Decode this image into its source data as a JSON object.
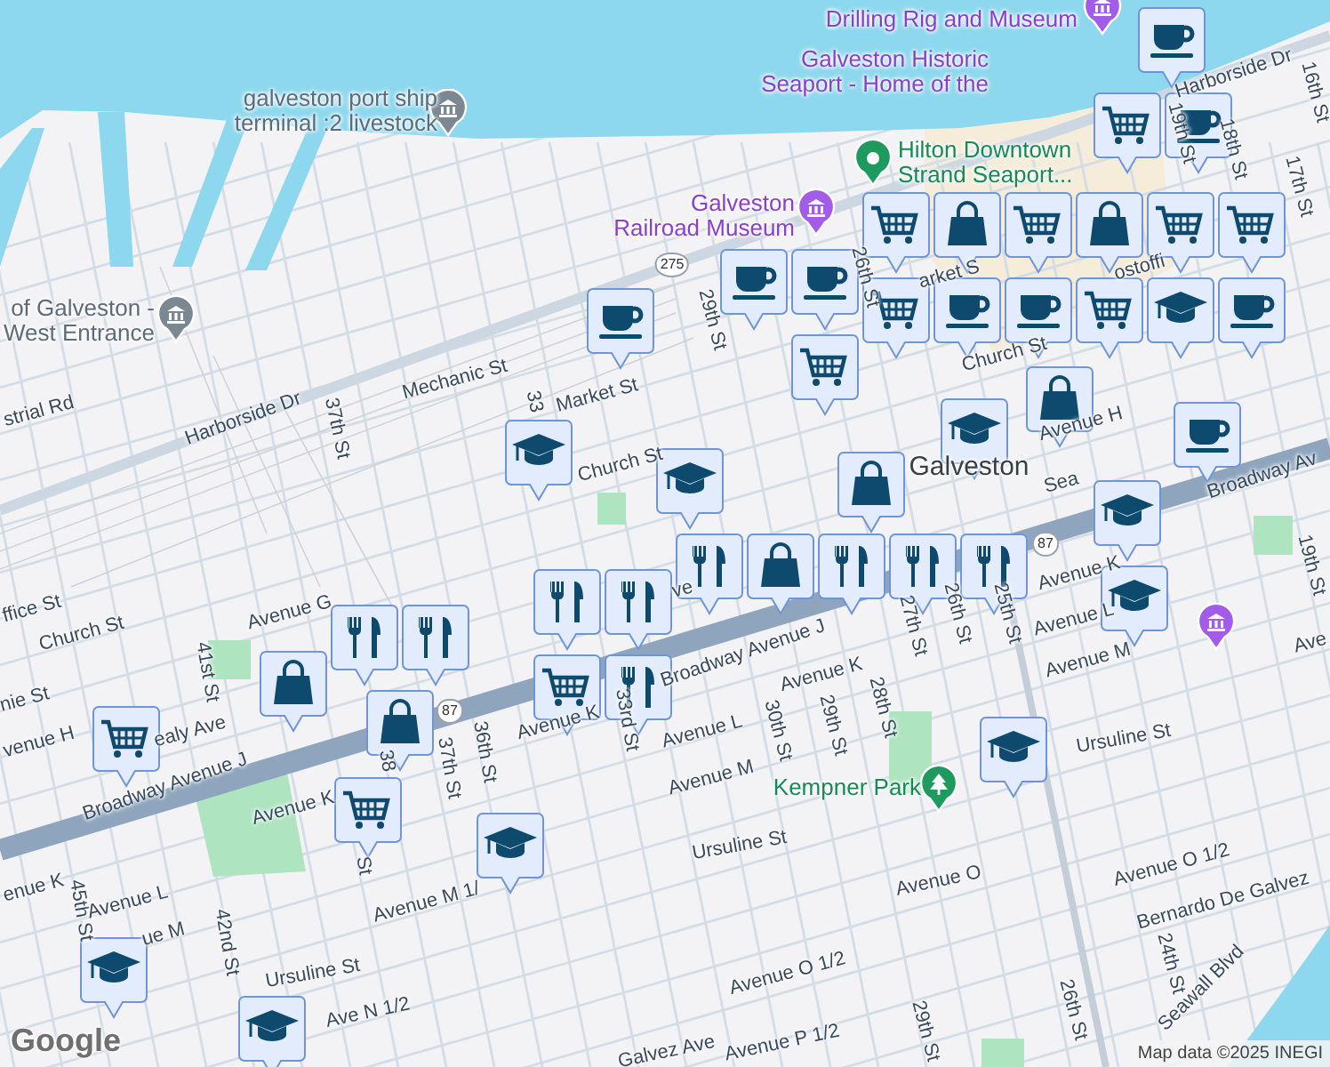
{
  "map": {
    "poi_labels": [
      {
        "lines": [
          "galveston port ship",
          "terminal :2 livestock"
        ],
        "kind": "landmark"
      },
      {
        "lines": [
          "of Galveston -",
          "West Entrance"
        ],
        "kind": "landmark"
      },
      {
        "lines": [
          "Galveston",
          "Railroad Museum"
        ],
        "kind": "attraction"
      },
      {
        "lines": [
          "Drilling Rig and Museum"
        ],
        "kind": "attraction"
      },
      {
        "lines": [
          "Galveston Historic",
          "Seaport - Home of the"
        ],
        "kind": "attraction"
      },
      {
        "lines": [
          "Hilton Downtown",
          "Strand Seaport..."
        ],
        "kind": "hotel"
      },
      {
        "lines": [
          "Galveston"
        ],
        "kind": "city"
      },
      {
        "lines": [
          "Kempner Park"
        ],
        "kind": "park"
      }
    ],
    "places": [
      {
        "kind": "landmark"
      },
      {
        "kind": "landmark"
      },
      {
        "kind": "attraction"
      },
      {
        "kind": "attraction"
      },
      {
        "kind": "hotel"
      },
      {
        "kind": "attraction"
      },
      {
        "kind": "park"
      }
    ],
    "streets": [
      "strial Rd",
      "Harborside Dr",
      "Mechanic St",
      "37th St",
      "33",
      "Market St",
      "Church St",
      "29th St",
      "26th St",
      "arket S",
      "Church St",
      "Harborside Dr",
      "19th St",
      "18th St",
      "17th St",
      "16th St",
      "ostoffi",
      "Avenue H",
      "Sea",
      "Broadway Av",
      "Avenue K",
      "Avenue L",
      "Avenue M",
      "19th St",
      "ffice St",
      "Church St",
      "Avenue G",
      "nie St",
      "venue H",
      "ealy Ave",
      "41st St",
      "Broadway Avenue J",
      "Avenue K",
      "38",
      "37th St",
      "36th St",
      "Avenue K",
      "33rd St",
      "St",
      "enue K",
      "45th St",
      "Avenue L",
      "ue M",
      "42nd St",
      "Avenue M 1/",
      "Ursuline St",
      "Ave N 1/2",
      "ve",
      "Broadway Avenue J",
      "Avenue K",
      "27th St",
      "26th St",
      "25th St",
      "30th St",
      "29th St",
      "28th St",
      "Avenue L",
      "Avenue M",
      "Ursuline St",
      "Ursuline St",
      "Avenue O",
      "Avenue O 1/2",
      "Bernardo De Galvez",
      "24th St",
      "Seawall Blvd",
      "26th St",
      "Avenue O 1/2",
      "29th St",
      "Avenue P 1/2",
      "Galvez Ave",
      "Ave"
    ],
    "route_shields": [
      "275",
      "87",
      "87"
    ],
    "markers": [
      {
        "kind": "cafe"
      },
      {
        "kind": "school"
      },
      {
        "kind": "school"
      },
      {
        "kind": "cafe"
      },
      {
        "kind": "cafe"
      },
      {
        "kind": "cart"
      },
      {
        "kind": "cart"
      },
      {
        "kind": "shop"
      },
      {
        "kind": "cart"
      },
      {
        "kind": "shop"
      },
      {
        "kind": "cart"
      },
      {
        "kind": "cart"
      },
      {
        "kind": "cart"
      },
      {
        "kind": "cart"
      },
      {
        "kind": "cafe"
      },
      {
        "kind": "cafe"
      },
      {
        "kind": "cafe"
      },
      {
        "kind": "cafe"
      },
      {
        "kind": "cart"
      },
      {
        "kind": "school"
      },
      {
        "kind": "cafe"
      },
      {
        "kind": "school"
      },
      {
        "kind": "cafe"
      },
      {
        "kind": "school"
      },
      {
        "kind": "shop"
      },
      {
        "kind": "shop"
      },
      {
        "kind": "shop"
      },
      {
        "kind": "food"
      },
      {
        "kind": "food"
      },
      {
        "kind": "food"
      },
      {
        "kind": "food"
      },
      {
        "kind": "food"
      },
      {
        "kind": "food"
      },
      {
        "kind": "food"
      },
      {
        "kind": "cart"
      },
      {
        "kind": "food"
      },
      {
        "kind": "food"
      },
      {
        "kind": "shop"
      },
      {
        "kind": "shop"
      },
      {
        "kind": "cart"
      },
      {
        "kind": "cart"
      },
      {
        "kind": "school"
      },
      {
        "kind": "school"
      },
      {
        "kind": "school"
      },
      {
        "kind": "school"
      },
      {
        "kind": "school"
      }
    ],
    "logo": "Google",
    "attribution": "Map data ©2025 INEGI"
  }
}
